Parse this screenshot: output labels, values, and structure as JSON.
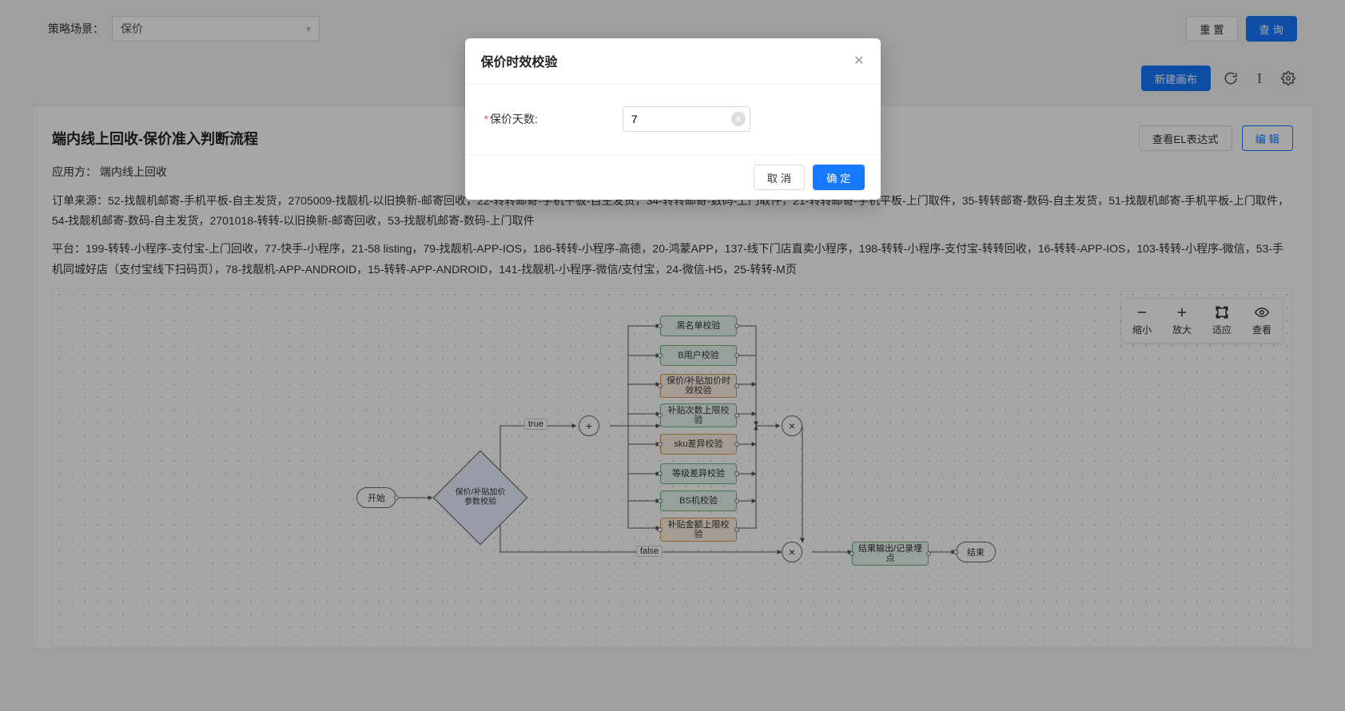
{
  "filter": {
    "label": "策略场景：",
    "value": "保价",
    "reset": "重 置",
    "search": "查 询"
  },
  "toolbar": {
    "new_canvas": "新建画布",
    "refresh_icon": "refresh",
    "edit_text_icon": "I",
    "settings_icon": "gear"
  },
  "card": {
    "title": "端内线上回收-保价准入判断流程",
    "view_expr": "查看EL表达式",
    "edit": "编 辑",
    "app_label": "应用方：",
    "app_value": "端内线上回收",
    "order_sources": "订单来源：52-找靓机邮寄-手机平板-自主发货，2705009-找靓机-以旧换新-邮寄回收，22-转转邮寄-手机平板-自主发货，34-转转邮寄-数码-上门取件，21-转转邮寄-手机平板-上门取件，35-转转邮寄-数码-自主发货，51-找靓机邮寄-手机平板-上门取件，54-找靓机邮寄-数码-自主发货，2701018-转转-以旧换新-邮寄回收，53-找靓机邮寄-数码-上门取件",
    "platforms": "平台：199-转转-小程序-支付宝-上门回收，77-快手-小程序，21-58 listing，79-找靓机-APP-IOS，186-转转-小程序-高德，20-鸿蒙APP，137-线下门店直卖小程序，198-转转-小程序-支付宝-转转回收，16-转转-APP-IOS，103-转转-小程序-微信，53-手机同城好店（支付宝线下扫码页），78-找靓机-APP-ANDROID，15-转转-APP-ANDROID，141-找靓机-小程序-微信/支付宝，24-微信-H5，25-转转-M页"
  },
  "zoom": {
    "out": "缩小",
    "in": "放大",
    "fit": "适应",
    "view": "查看"
  },
  "flow": {
    "start": "开始",
    "end": "结束",
    "diamond": "保价/补贴加价参数校验",
    "true": "true",
    "false": "false",
    "rects": [
      "黑名单校验",
      "B用户校验",
      "保价/补贴加价时效校验",
      "补贴次数上限校验",
      "sku差异校验",
      "等级差异校验",
      "BS机校验",
      "补贴金额上限校验"
    ],
    "result_node": "结果输出/记录埋点"
  },
  "modal": {
    "title": "保价时效校验",
    "field_label": "保价天数:",
    "value": "7",
    "cancel": "取 消",
    "ok": "确 定"
  }
}
